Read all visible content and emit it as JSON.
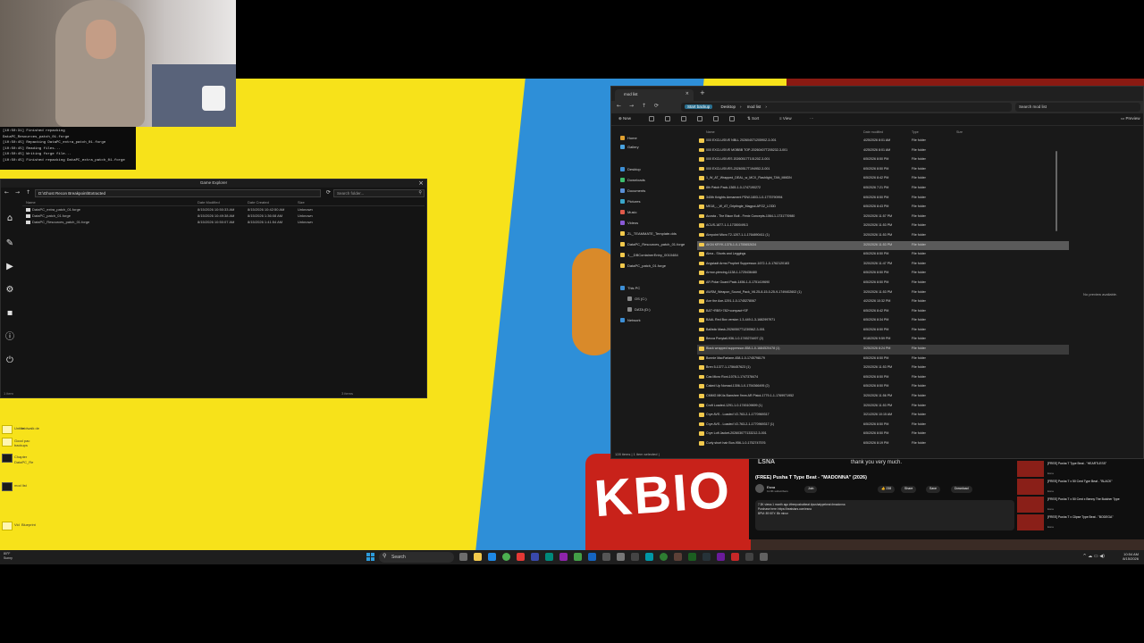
{
  "console": {
    "lines": [
      "[10:50:31] Finished repacking",
      "DataPC_Resources_patch_01.forge",
      "[10:50:45] Repacking DataPC_extra_patch_01.forge",
      "[10:50:45] Reading files...",
      "[10:50:45] Writing forge file...",
      "[10:50:45] Finished repacking DataPC_extra_patch_01.forge"
    ]
  },
  "game_explorer": {
    "title": "Game Explorer",
    "path": "D:\\Ghost Recon Breakpoint\\Extracted",
    "search_placeholder": "Search folder...",
    "columns": [
      "Name",
      "Date Modified",
      "Date Created",
      "Size"
    ],
    "rows": [
      {
        "name": "DataPC_extra_patch_01.forge",
        "modified": "8/15/2026 10:50:33 AM",
        "created": "8/15/2026 10:42:50 AM",
        "size": "Unknown"
      },
      {
        "name": "DataPC_patch_01.forge",
        "modified": "8/15/2026 10:49:38 AM",
        "created": "8/15/2026 1:36:08 AM",
        "size": "Unknown"
      },
      {
        "name": "DataPC_Resources_patch_01.forge",
        "modified": "8/15/2026 10:50:07 AM",
        "created": "8/15/2026 1:41:54 AM",
        "size": "Unknown"
      }
    ],
    "status_left": "1 item",
    "status_right": "3 items"
  },
  "file_explorer": {
    "tab_title": "mod list",
    "breadcrumb_backup": "Start backup",
    "breadcrumbs": [
      "Desktop",
      "mod list"
    ],
    "search_placeholder": "Search mod list",
    "commands": {
      "new": "New",
      "sort": "Sort",
      "view": "View",
      "preview": "Preview"
    },
    "nav": [
      {
        "label": "Home",
        "color": "#e0a030"
      },
      {
        "label": "Gallery",
        "color": "#4aa3df"
      },
      {
        "label": "Desktop",
        "color": "#3d8fd6"
      },
      {
        "label": "Downloads",
        "color": "#3dbd6d"
      },
      {
        "label": "Documents",
        "color": "#5a8fd6"
      },
      {
        "label": "Pictures",
        "color": "#3aa6c9"
      },
      {
        "label": "Music",
        "color": "#e05a4a"
      },
      {
        "label": "Videos",
        "color": "#8a5ad6"
      },
      {
        "label": "ZL_TEAMMATE_Template.dds",
        "color": "#f2c94c"
      },
      {
        "label": "DataPC_Resources_patch_01.forge",
        "color": "#f2c94c"
      },
      {
        "label": "1__DBContainerEntry_0010484",
        "color": "#f2c94c"
      },
      {
        "label": "DataPC_patch_01.forge",
        "color": "#f2c94c"
      },
      {
        "label": "This PC",
        "color": "#3d8fd6"
      },
      {
        "label": "OS (C:)",
        "color": "#888888"
      },
      {
        "label": "DATA (D:)",
        "color": "#888888"
      },
      {
        "label": "Network",
        "color": "#3d8fd6"
      }
    ],
    "columns": [
      "Name",
      "Date modified",
      "Type",
      "Size"
    ],
    "rows": [
      {
        "name": "000 EXCLUSIVE NBLL 20260407120590Z-3-001",
        "date": "4/25/2026 8:01 AM",
        "type": "File folder"
      },
      {
        "name": "000 EXCLUSIVE MOBBB TOP-20260407T205232-3-001",
        "date": "4/25/2026 8:01 AM",
        "type": "File folder"
      },
      {
        "name": "000 EXCLUSIVES 20260517T10120Z-3-001",
        "date": "6/5/2026 8:50 PM",
        "type": "File folder"
      },
      {
        "name": "000 EXCLUSIVES-20260517T194952-3-001",
        "date": "6/5/2026 8:50 PM",
        "type": "File folder"
      },
      {
        "name": "1_W_AT_Wrapped_DEAL_w_MCX_Flashlight_TAN_MMDN",
        "date": "6/5/2026 8:42 PM",
        "type": "File folder"
      },
      {
        "name": "8th Patch Pack-1365-1-0-1747190272",
        "date": "6/5/2026 7:21 PM",
        "type": "File folder"
      },
      {
        "name": "340th Knights Armament PDW-1803-1-0-1775790994",
        "date": "6/5/2026 8:50 PM",
        "type": "File folder"
      },
      {
        "name": "MK18_-_W_AT_Griptingle_Magpul-AFG2_LODD",
        "date": "6/5/2026 8:43 PM",
        "type": "File folder"
      },
      {
        "name": "Acosta - The Bison Bolt - Fenix Concepts-1064-1-1731770980",
        "date": "3/20/2026 11:57 PM",
        "type": "File folder"
      },
      {
        "name": "ACUS-1877-1-1-1735004913",
        "date": "3/20/2026 11:53 PM",
        "type": "File folder"
      },
      {
        "name": "Aimpoint Micro T2-1207-1-1-1764890411 (1)",
        "date": "3/20/2026 11:53 PM",
        "type": "File folder"
      },
      {
        "name": "AK04 KRYK-1376-1-0-1755652634",
        "date": "3/20/2026 11:53 PM",
        "type": "File folder"
      },
      {
        "name": "Alma - Shorts and Leggings",
        "date": "6/5/2026 8:50 PM",
        "type": "File folder"
      },
      {
        "name": "Angstadt Arms Prophet Suppressor-1672-1-0-1762120183",
        "date": "3/20/2026 11:47 PM",
        "type": "File folder"
      },
      {
        "name": "Armor-piercing-1138-1-1725436480",
        "date": "6/5/2026 8:50 PM",
        "type": "File folder"
      },
      {
        "name": "AR Polar Guard Pack-1456-1-0-1751419690",
        "date": "6/5/2026 8:50 PM",
        "type": "File folder"
      },
      {
        "name": "AWSM_Weapon_Sound_Pack_V6.25-8-15-0-25-9-1749402602 (1)",
        "date": "3/20/2026 11:53 PM",
        "type": "File folder"
      },
      {
        "name": "Axe the Axe-1291-1-0-1745278067",
        "date": "4/2/2026 10:32 PM",
        "type": "File folder"
      },
      {
        "name": "B&T+RBS+782+compact+SF",
        "date": "6/5/2026 8:42 PM",
        "type": "File folder"
      },
      {
        "name": "BAAL Red Box version 1.3-449-1-3-1682997971",
        "date": "6/5/2026 8:34 PM",
        "type": "File folder"
      },
      {
        "name": "Ballistic Mask-20260507T123056Z-3-001",
        "date": "6/5/2026 8:50 PM",
        "type": "File folder"
      },
      {
        "name": "Becca Ponytail-936-1-0-1745274497 (2)",
        "date": "6/18/2026 9:59 PM",
        "type": "File folder"
      },
      {
        "name": "Black wrapped suppressor-858-1-0-1684520478 (1)",
        "date": "3/25/2026 8:24 PM",
        "type": "File folder"
      },
      {
        "name": "Bonnie MacFarlane-458-1-0-1745798179",
        "date": "6/5/2026 8:50 PM",
        "type": "File folder"
      },
      {
        "name": "Bren 5-1377-1-1756457623 (1)",
        "date": "3/20/2026 11:53 PM",
        "type": "File folder"
      },
      {
        "name": "Cas Micro Roni-1078-1-1747378474",
        "date": "6/5/2026 8:50 PM",
        "type": "File folder"
      },
      {
        "name": "Caked Up Nomad-1306-1-0-1754366495 (2)",
        "date": "6/5/2026 8:50 PM",
        "type": "File folder"
      },
      {
        "name": "CMMG MK4s Banshee 9mm AR Pistol-1779-1-1-1769971952",
        "date": "3/20/2026 11:56 PM",
        "type": "File folder"
      },
      {
        "name": "Croft Loaded-1291-1-0-1745109699 (1)",
        "date": "3/20/2026 11:53 PM",
        "type": "File folder"
      },
      {
        "name": "Crye AVS - Loaded V2-763-2-1-1770969317",
        "date": "3/21/2026 10:15 AM",
        "type": "File folder"
      },
      {
        "name": "Crye AVS - Loaded V2-763-2-1-1770969317 (1)",
        "date": "6/5/2026 8:50 PM",
        "type": "File folder"
      },
      {
        "name": "Crye Loft Jacket-20260307T133212-3-001",
        "date": "6/5/2026 8:50 PM",
        "type": "File folder"
      },
      {
        "name": "Curly short hair Bun-956-1-0-1752747576",
        "date": "6/5/2026 8:19 PM",
        "type": "File folder"
      }
    ],
    "selected_index": 11,
    "hover_index": 22,
    "preview_text": "No preview available.",
    "status": "128 items  |  1 item selected  |"
  },
  "youtube": {
    "top_caption": "thank you very much.",
    "logo_text": "LSNA",
    "title": "(FREE) Pusha T Type Beat - \"MADONNA\" (2026)",
    "channel": "Esna",
    "subs": "11.9K subscribers",
    "buttons": [
      "Join",
      "238",
      "Share",
      "Save",
      "Download"
    ],
    "desc": [
      "7.3K views  1 month ago  #freepushatbeat #pushatypebeat #madonna",
      "Purchase here: https://beatstars.com/esna"
    ],
    "desc_link": "https://beatstars.com/esna",
    "bpm": "BPM: 89      KEY: Bb minor",
    "recs": [
      {
        "title": "[FREE] Pusha T Type Beat - \"HEARTLESS\"",
        "channel": "Esna"
      },
      {
        "title": "[FREE] Pusha T x 50 Cent Type Beat - \"BLACK\"",
        "channel": "Esna"
      },
      {
        "title": "[FREE] Pusha T x 50 Cent x Benny The Butcher Type",
        "channel": "Esna"
      },
      {
        "title": "[FREE] Pusha T x Clipse Type Beat - \"BODEGA\"",
        "channel": "Esna"
      }
    ]
  },
  "desktop_icons": [
    {
      "label": "Untitle",
      "sub": "midwalk de",
      "dark": false
    },
    {
      "label": "Good pac",
      "sub": "backups",
      "dark": false
    },
    {
      "label": "Chapter",
      "sub": "DataPC_Re",
      "dark": true
    },
    {
      "label": "mod list",
      "sub": "",
      "dark": true
    },
    {
      "label": "Vid",
      "sub": "Blueprint",
      "dark": false
    }
  ],
  "taskbar": {
    "weather_temp": "80°F",
    "weather_desc": "Sunny",
    "search_label": "Search",
    "time": "10:54 AM",
    "date": "8/15/2026",
    "sys_icons": "^  ☁  ▭  ◀)"
  },
  "wallpaper_text": "KBIO"
}
